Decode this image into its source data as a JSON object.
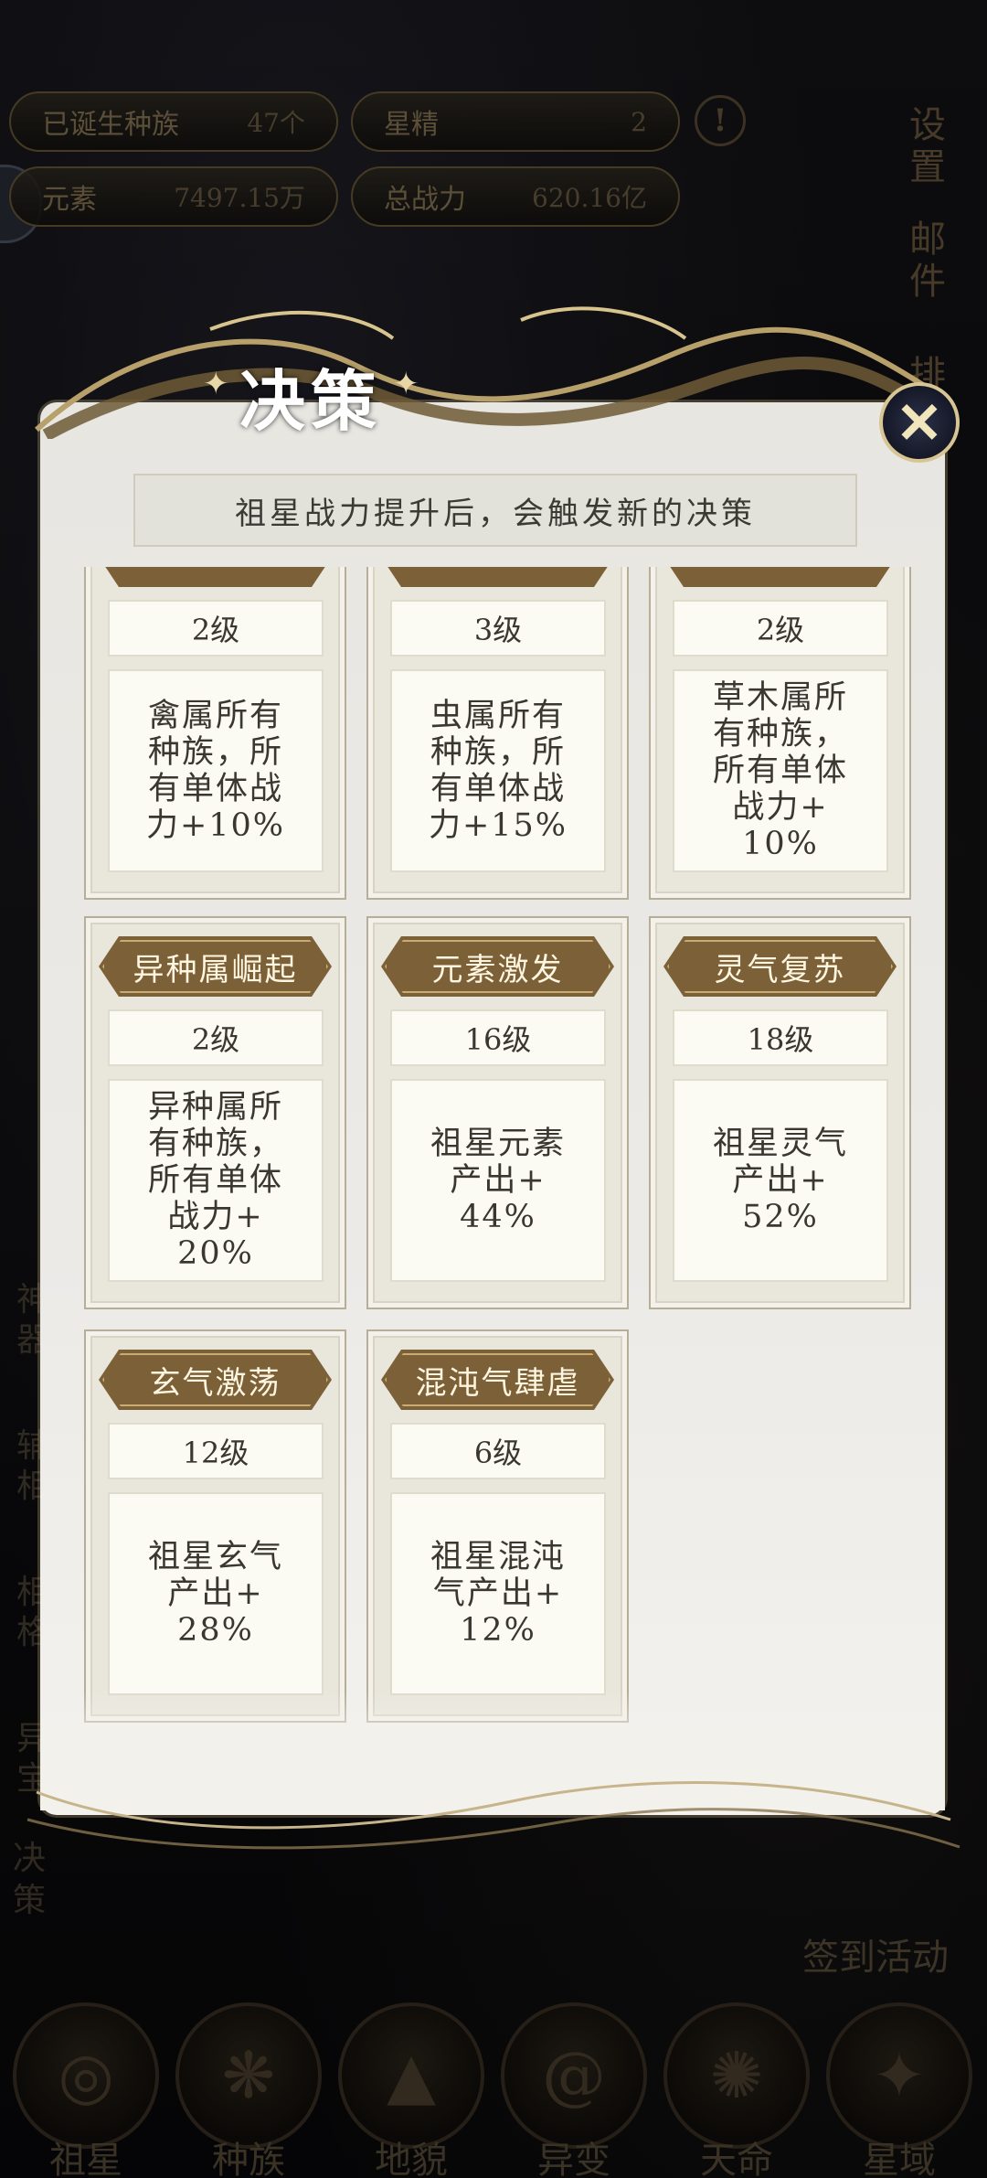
{
  "top_stats": [
    {
      "label": "已诞生种族",
      "value": "47个"
    },
    {
      "label": "星精",
      "value": "2"
    },
    {
      "label": "元素",
      "value": "7497.15万"
    },
    {
      "label": "总战力",
      "value": "620.16亿"
    }
  ],
  "side_menu": [
    "设\n置",
    "邮\n件",
    "排"
  ],
  "left_labels": [
    "神\n器",
    "辅\n相",
    "相\n格",
    "异\n宝"
  ],
  "decision_button": "决\n策",
  "sign_activity": "签到活动",
  "bottom_nav": [
    {
      "label": "祖星",
      "icon": "planet-icon"
    },
    {
      "label": "种族",
      "icon": "race-icon"
    },
    {
      "label": "地貌",
      "icon": "terrain-icon"
    },
    {
      "label": "异变",
      "icon": "mutation-icon"
    },
    {
      "label": "天命",
      "icon": "destiny-icon"
    },
    {
      "label": "星域",
      "icon": "starfield-icon"
    }
  ],
  "dialog": {
    "title": "决策",
    "close_symbol": "✕",
    "hint": "祖星战力提升后，会触发新的决策",
    "cards": [
      {
        "name": "",
        "level": "2级",
        "desc": "禽属所有\n种族，所\n有单体战\n力+10%"
      },
      {
        "name": "",
        "level": "3级",
        "desc": "虫属所有\n种族，所\n有单体战\n力+15%"
      },
      {
        "name": "",
        "level": "2级",
        "desc": "草木属所\n有种族，\n所有单体\n战力+\n10%"
      },
      {
        "name": "异种属崛起",
        "level": "2级",
        "desc": "异种属所\n有种族，\n所有单体\n战力+\n20%"
      },
      {
        "name": "元素激发",
        "level": "16级",
        "desc": "祖星元素\n产出+\n44%"
      },
      {
        "name": "灵气复苏",
        "level": "18级",
        "desc": "祖星灵气\n产出+\n52%"
      },
      {
        "name": "玄气激荡",
        "level": "12级",
        "desc": "祖星玄气\n产出+\n28%"
      },
      {
        "name": "混沌气肆虐",
        "level": "6级",
        "desc": "祖星混沌\n气产出+\n12%"
      }
    ]
  }
}
